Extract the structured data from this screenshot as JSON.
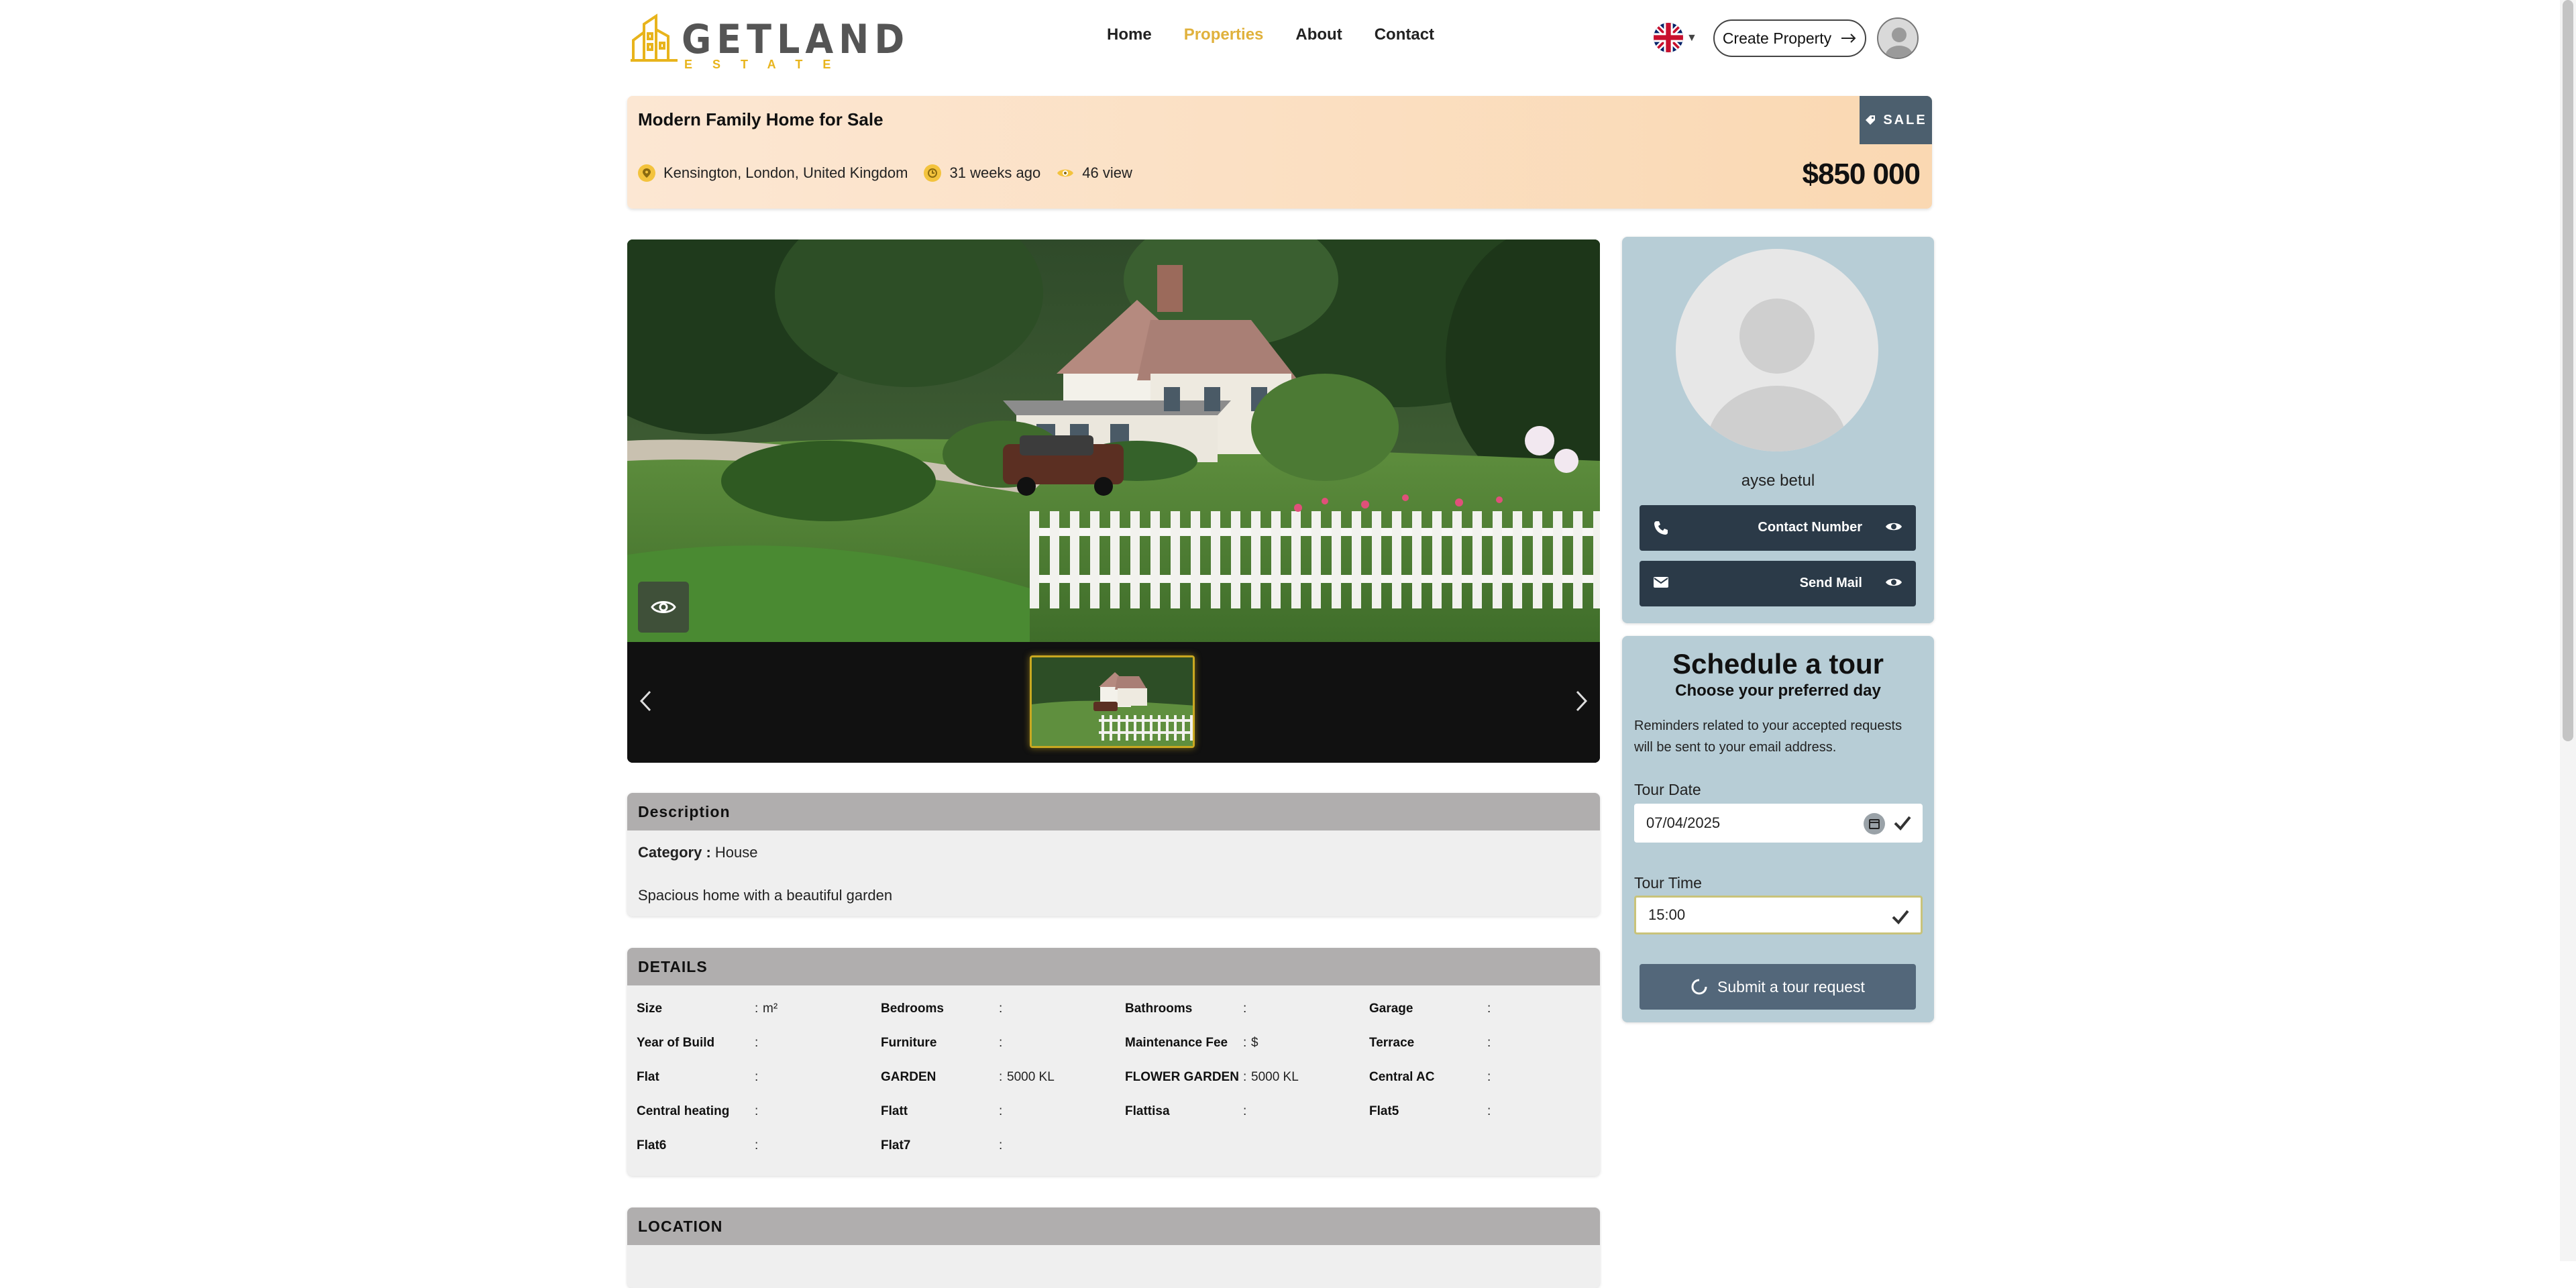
{
  "brand": {
    "name": "GETLAND",
    "sub": "ESTATE"
  },
  "nav": [
    {
      "label": "Home",
      "active": false
    },
    {
      "label": "Properties",
      "active": true
    },
    {
      "label": "About",
      "active": false
    },
    {
      "label": "Contact",
      "active": false
    }
  ],
  "header": {
    "create_label": "Create Property",
    "language": "en-GB"
  },
  "listing": {
    "title": "Modern Family Home for Sale",
    "location": "Kensington, London, United Kingdom",
    "age": "31 weeks ago",
    "views": "46 view",
    "badge": "SALE",
    "price": "$850 000"
  },
  "agent": {
    "name": "ayse betul",
    "contact_label": "Contact Number",
    "mail_label": "Send Mail"
  },
  "tour": {
    "title": "Schedule a tour",
    "subtitle": "Choose your preferred day",
    "note": "Reminders related to your accepted requests will be sent to your email address.",
    "date_label": "Tour Date",
    "date_value": "07/04/2025",
    "time_label": "Tour Time",
    "time_value": "15:00",
    "submit_label": "Submit a tour request"
  },
  "description": {
    "heading": "Description",
    "category_key": "Category :",
    "category_value": "House",
    "text": "Spacious home with a beautiful garden"
  },
  "details": {
    "heading": "DETAILS",
    "rows": [
      [
        {
          "k": "Size",
          "v": "m²"
        },
        {
          "k": "Bedrooms",
          "v": ""
        },
        {
          "k": "Bathrooms",
          "v": ""
        },
        {
          "k": "Garage",
          "v": ""
        }
      ],
      [
        {
          "k": "Year of Build",
          "v": ""
        },
        {
          "k": "Furniture",
          "v": ""
        },
        {
          "k": "Maintenance Fee",
          "v": "$"
        },
        {
          "k": "Terrace",
          "v": ""
        }
      ],
      [
        {
          "k": "Flat",
          "v": ""
        },
        {
          "k": "GARDEN",
          "v": "5000 KL"
        },
        {
          "k": "FLOWER GARDEN",
          "v": "5000 KL"
        },
        {
          "k": "Central AC",
          "v": ""
        }
      ],
      [
        {
          "k": "Central heating",
          "v": ""
        },
        {
          "k": "Flatt",
          "v": ""
        },
        {
          "k": "Flattisa",
          "v": ""
        },
        {
          "k": "Flat5",
          "v": ""
        }
      ],
      [
        {
          "k": "Flat6",
          "v": ""
        },
        {
          "k": "Flat7",
          "v": ""
        }
      ]
    ]
  },
  "location": {
    "heading": "LOCATION"
  },
  "colors": {
    "accent": "#e0b13c",
    "dark_button": "#2b3a48",
    "card_bg": "#b7cdd6",
    "banner_from": "#fce7d3",
    "banner_to": "#fad8b2"
  }
}
